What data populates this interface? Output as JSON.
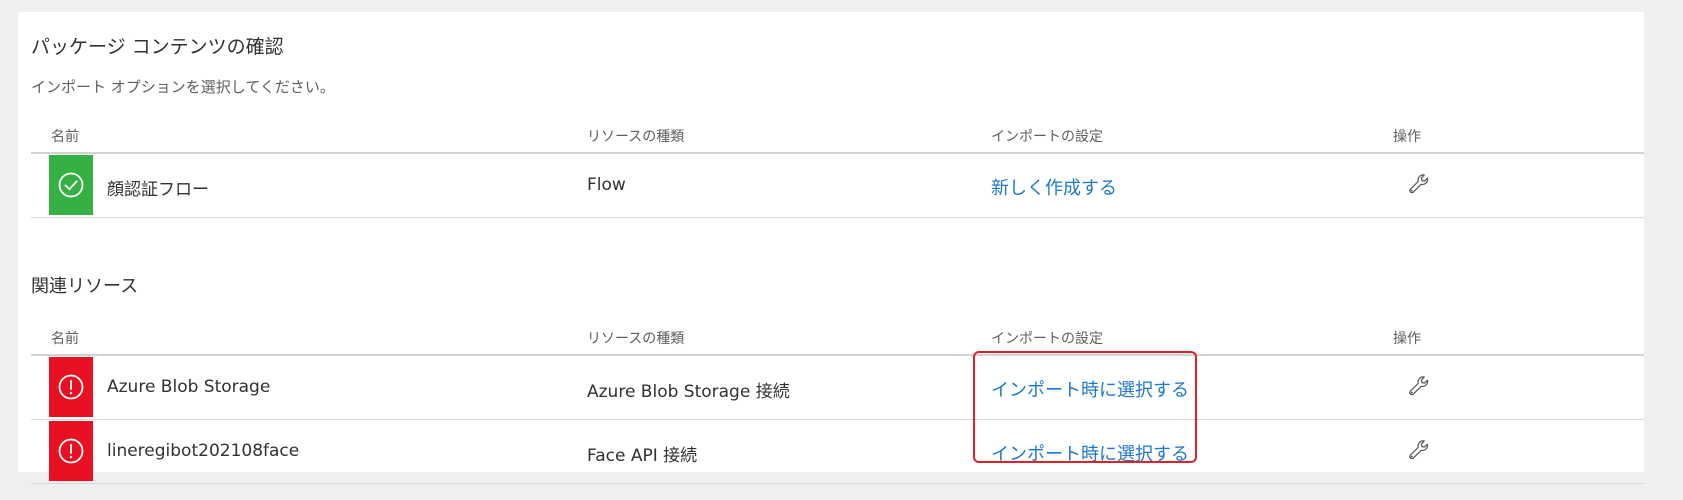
{
  "page": {
    "title": "パッケージ コンテンツの確認",
    "subtitle": "インポート オプションを選択してください。"
  },
  "columns": {
    "name": "名前",
    "type": "リソースの種類",
    "setting": "インポートの設定",
    "action": "操作"
  },
  "package_items": [
    {
      "status": "success",
      "status_icon": "check-circle-icon",
      "name": "顔認証フロー",
      "type": "Flow",
      "setting": "新しく作成する",
      "action_icon": "wrench-icon"
    }
  ],
  "related_section": {
    "title": "関連リソース"
  },
  "related_items": [
    {
      "status": "error",
      "status_icon": "alert-circle-icon",
      "name": "Azure Blob Storage",
      "type": "Azure Blob Storage 接続",
      "setting": "インポート時に選択する",
      "action_icon": "wrench-icon"
    },
    {
      "status": "error",
      "status_icon": "alert-circle-icon",
      "name": "lineregibot202108face",
      "type": "Face API 接続",
      "setting": "インポート時に選択する",
      "action_icon": "wrench-icon"
    }
  ],
  "colors": {
    "success": "#35b043",
    "error": "#e81123",
    "link": "#1e78c8",
    "highlight_border": "#e0202a"
  }
}
